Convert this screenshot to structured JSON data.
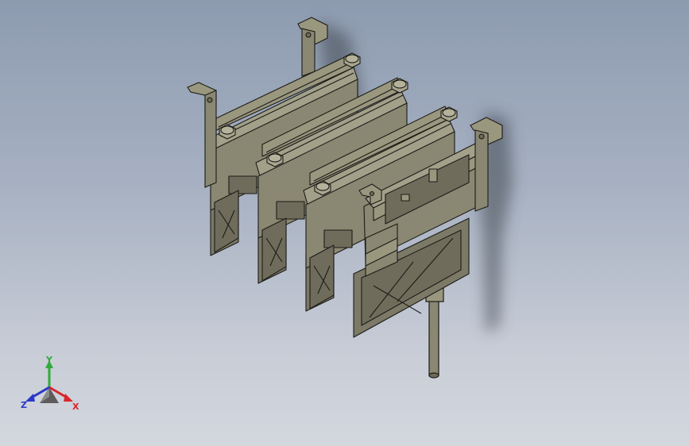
{
  "viewport": {
    "background_top": "#8d9bb0",
    "background_bottom": "#d4d7de"
  },
  "model": {
    "body_color": "#8a8772",
    "edge_color": "#1c1c18",
    "bolt_color": "#9a977f",
    "module_count": 3
  },
  "triad": {
    "x_label": "X",
    "y_label": "Y",
    "z_label": "Z",
    "x_color": "#d8262a",
    "y_color": "#2faa3a",
    "z_color": "#2a39c9"
  }
}
